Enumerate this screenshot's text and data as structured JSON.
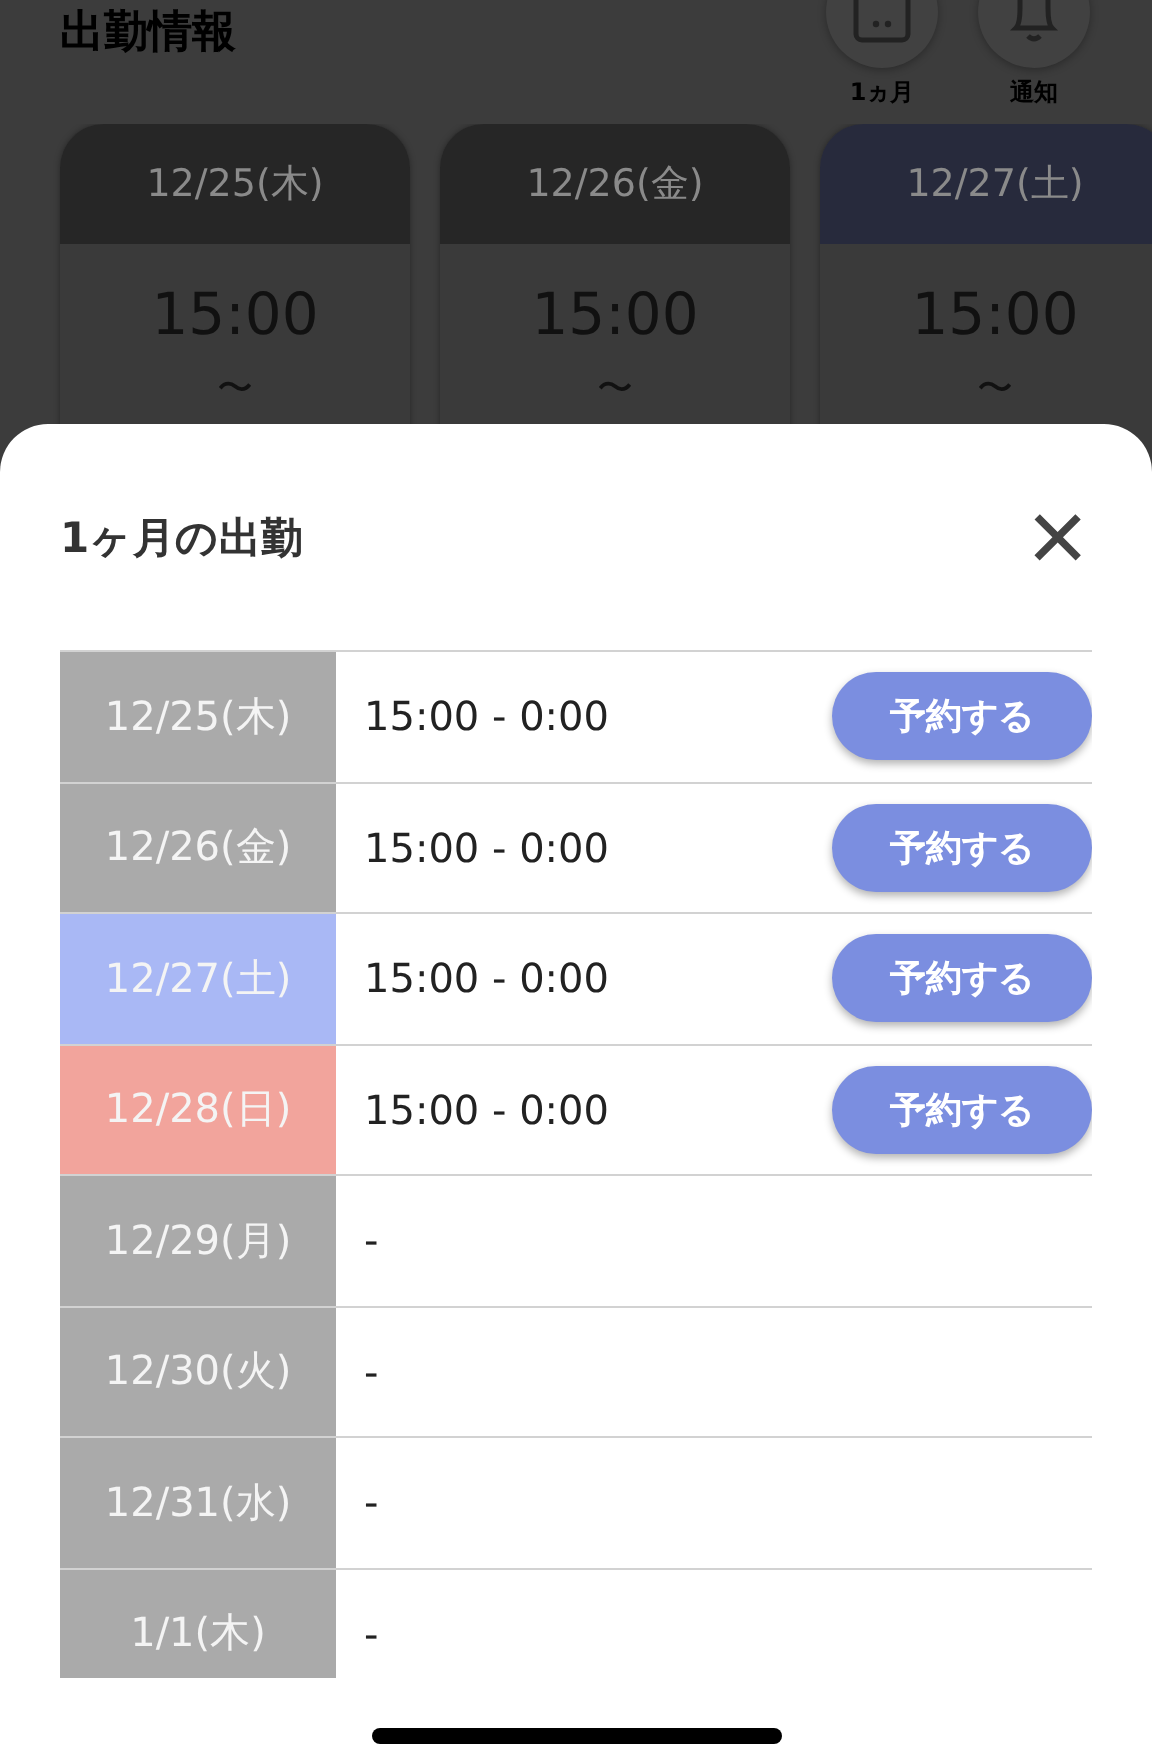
{
  "page": {
    "title": "出勤情報",
    "actions": [
      {
        "kind": "calendar",
        "label": "1ヵ月"
      },
      {
        "kind": "bell",
        "label": "通知"
      }
    ]
  },
  "cards": [
    {
      "date": "12/25(木)",
      "color": "#262626",
      "start": "15:00",
      "separator": "〜"
    },
    {
      "date": "12/26(金)",
      "color": "#262626",
      "start": "15:00",
      "separator": "〜"
    },
    {
      "date": "12/27(土)",
      "color": "#272a3c",
      "start": "15:00",
      "separator": "〜"
    }
  ],
  "sheet": {
    "title": "1ヶ月の出勤",
    "close": "×",
    "rows": [
      {
        "date": "12/25(木)",
        "color": "#aaaaaa",
        "time": "15:00 - 0:00",
        "button": "予約する"
      },
      {
        "date": "12/26(金)",
        "color": "#aaaaaa",
        "time": "15:00 - 0:00",
        "button": "予約する"
      },
      {
        "date": "12/27(土)",
        "color": "#a9b8f5",
        "time": "15:00 - 0:00",
        "button": "予約する"
      },
      {
        "date": "12/28(日)",
        "color": "#f2a49c",
        "time": "15:00 - 0:00",
        "button": "予約する"
      },
      {
        "date": "12/29(月)",
        "color": "#aaaaaa",
        "time": "-"
      },
      {
        "date": "12/30(火)",
        "color": "#aaaaaa",
        "time": "-"
      },
      {
        "date": "12/31(水)",
        "color": "#aaaaaa",
        "time": "-"
      },
      {
        "date": "1/1(木)",
        "color": "#aaaaaa",
        "time": "-"
      }
    ]
  }
}
